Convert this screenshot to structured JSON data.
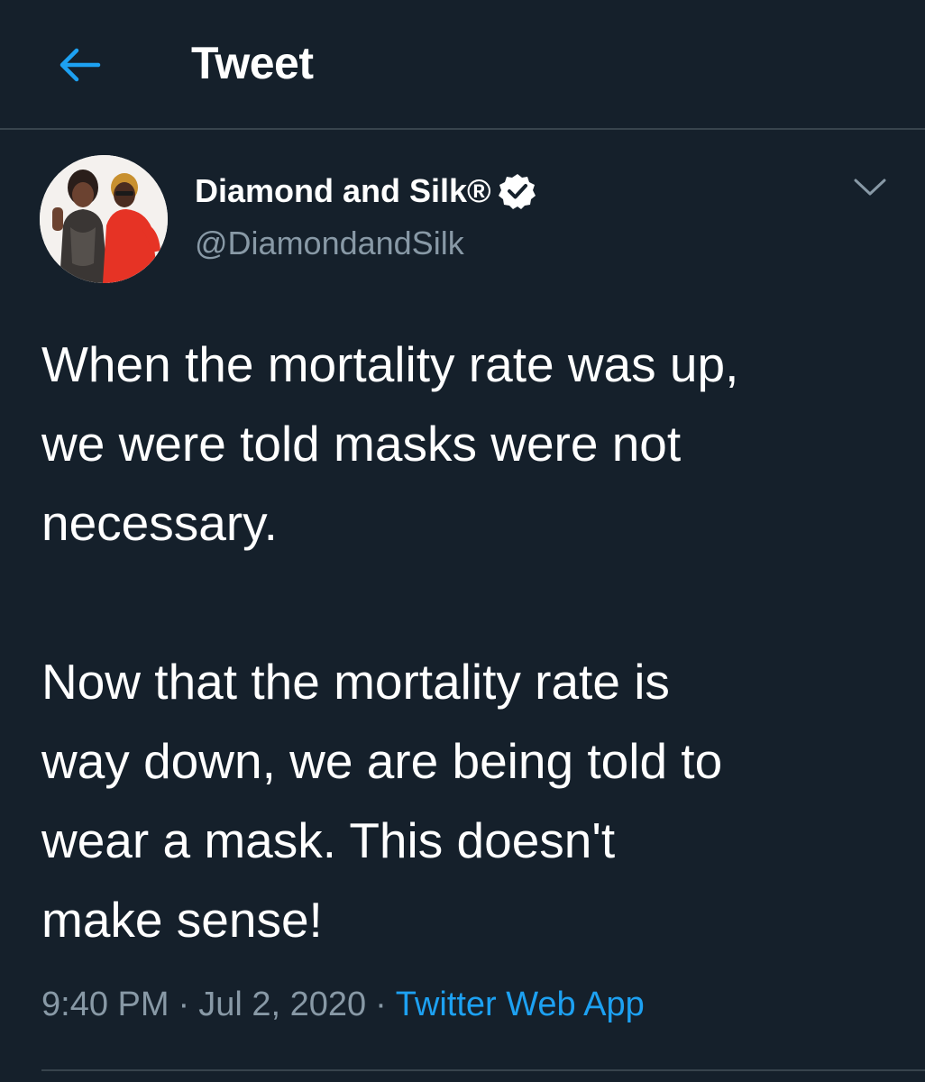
{
  "header": {
    "title": "Tweet",
    "back_icon": "arrow-left-icon"
  },
  "tweet": {
    "author": {
      "display_name": "Diamond and Silk®",
      "handle": "@DiamondandSilk",
      "verified_icon": "verified-badge-icon"
    },
    "menu_icon": "chevron-down-icon",
    "paragraphs": [
      "When the mortality rate was up,\nwe were told masks were not\nnecessary.",
      "Now that the mortality rate is\nway down, we are being told to\nwear a mask.  This doesn't\nmake sense!"
    ],
    "time": "9:40 PM",
    "separator": "·",
    "date": "Jul 2, 2020",
    "source": "Twitter Web App"
  },
  "colors": {
    "background": "#15202b",
    "accent": "#1da1f2",
    "secondary_text": "#8899a6",
    "divider": "#38444d"
  }
}
